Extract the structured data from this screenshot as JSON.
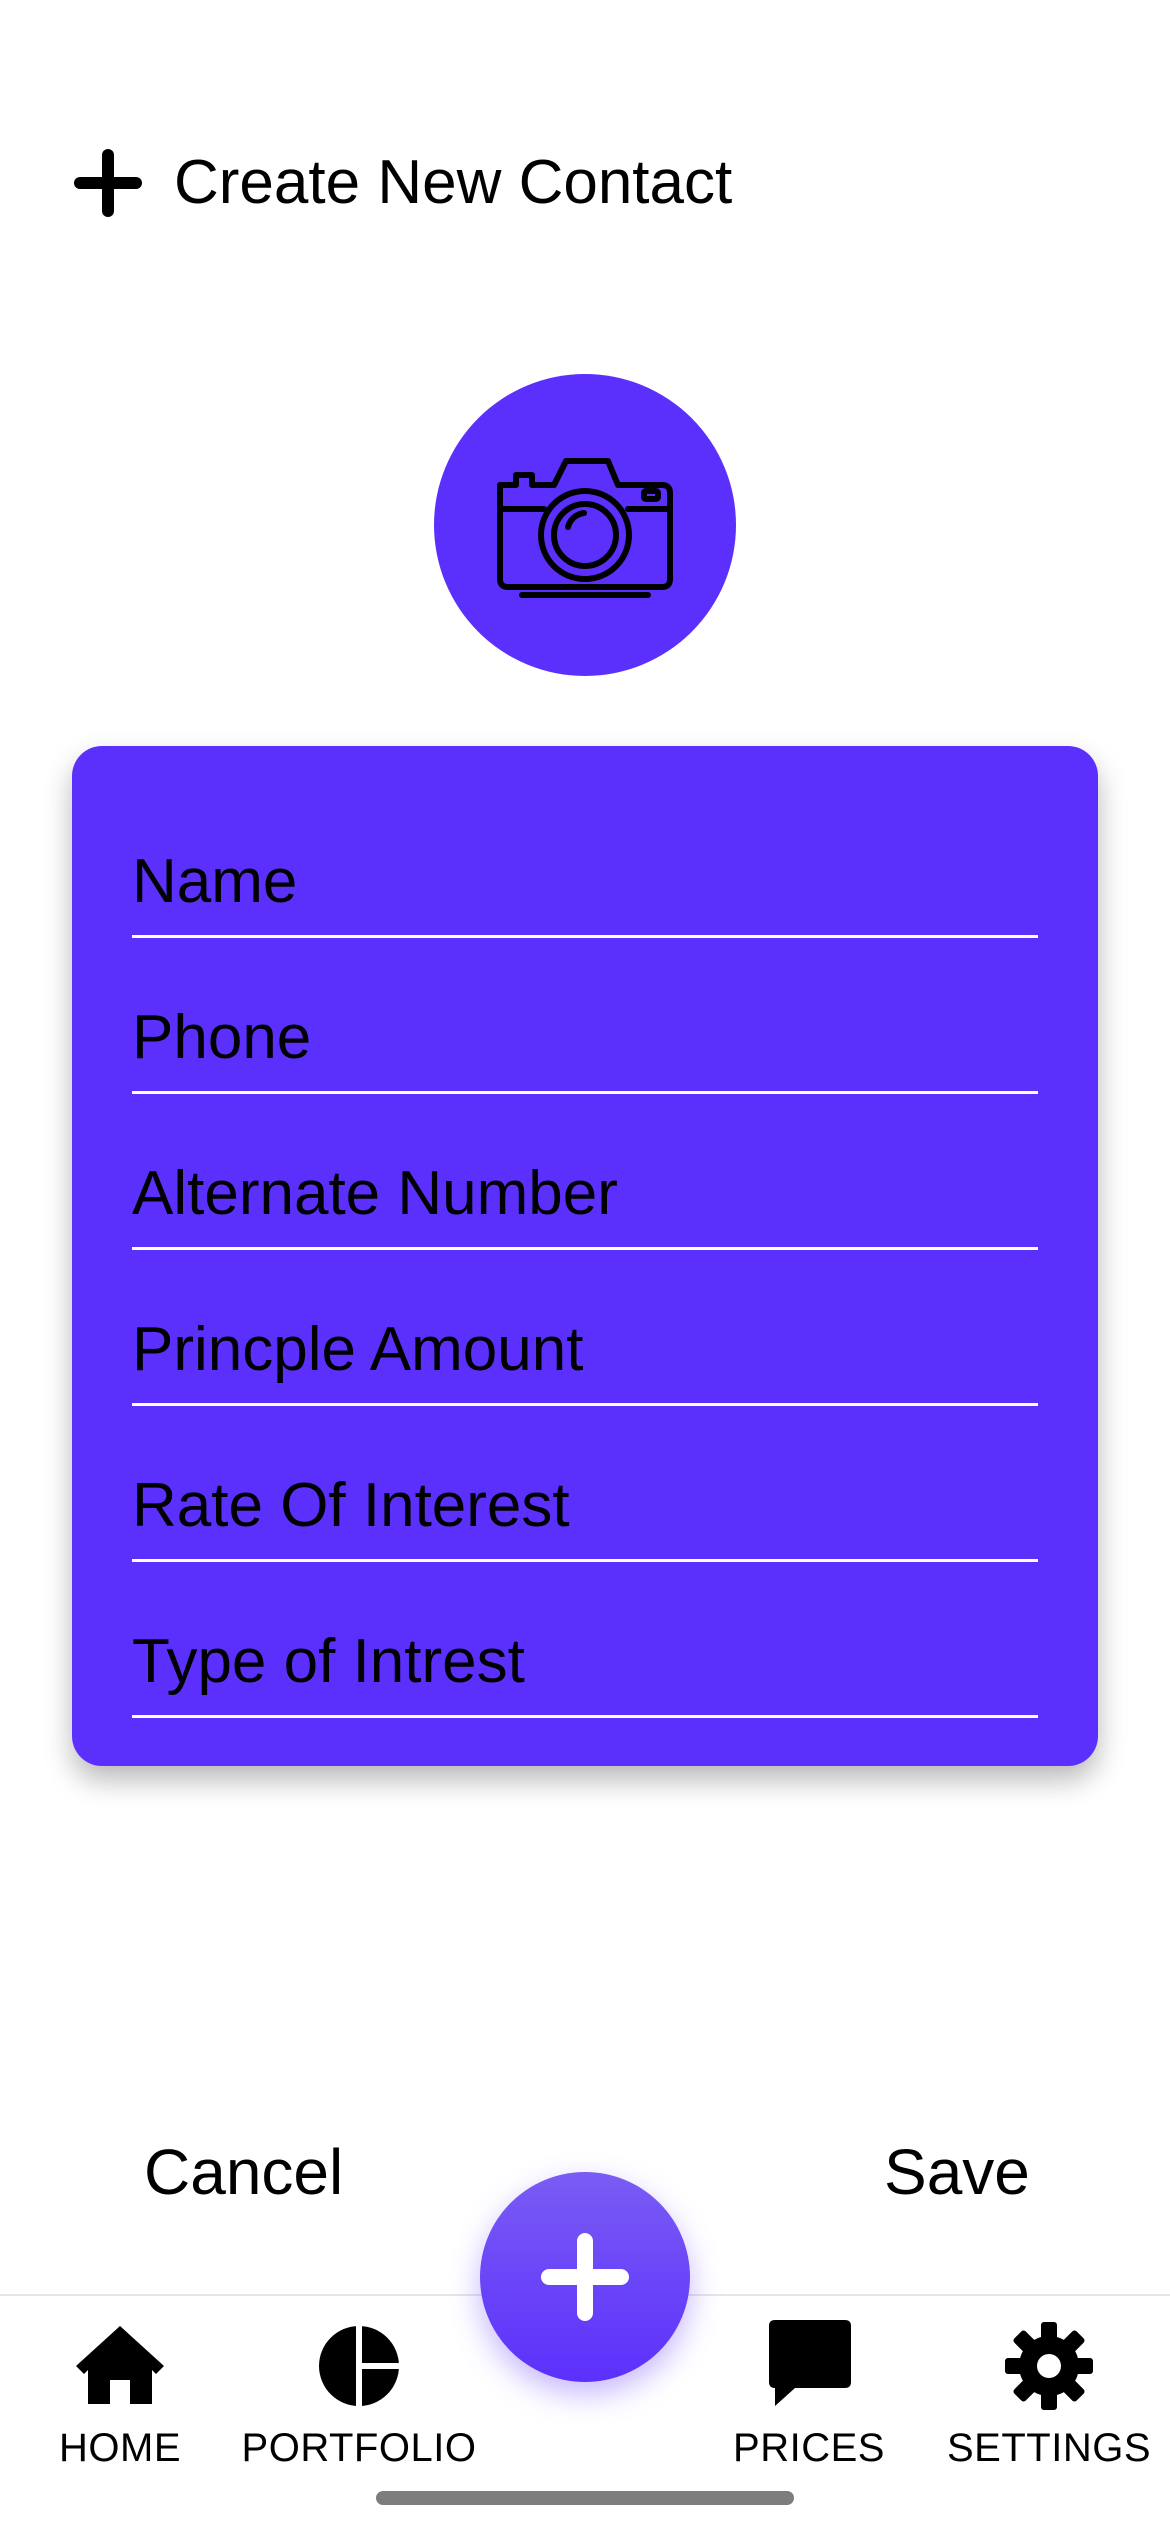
{
  "header": {
    "title": "Create New Contact",
    "icon": "plus-icon"
  },
  "photo": {
    "icon": "camera-icon",
    "color": "#5c30fc"
  },
  "form": {
    "fields": [
      {
        "placeholder": "Name",
        "value": ""
      },
      {
        "placeholder": "Phone",
        "value": ""
      },
      {
        "placeholder": "Alternate Number",
        "value": ""
      },
      {
        "placeholder": "Princple Amount",
        "value": ""
      },
      {
        "placeholder": "Rate Of Interest",
        "value": ""
      },
      {
        "placeholder": "Type of Intrest",
        "value": ""
      }
    ]
  },
  "actions": {
    "cancel_label": "Cancel",
    "save_label": "Save"
  },
  "fab": {
    "icon": "plus-icon"
  },
  "tabbar": {
    "items": [
      {
        "label": "HOME",
        "icon": "home-icon"
      },
      {
        "label": "PORTFOLIO",
        "icon": "pie-chart-icon"
      },
      {
        "label": "PRICES",
        "icon": "chat-bubble-icon"
      },
      {
        "label": "SETTINGS",
        "icon": "gear-icon"
      }
    ]
  },
  "colors": {
    "accent": "#5c30fc",
    "field_line": "#ffffff",
    "text": "#000000"
  }
}
